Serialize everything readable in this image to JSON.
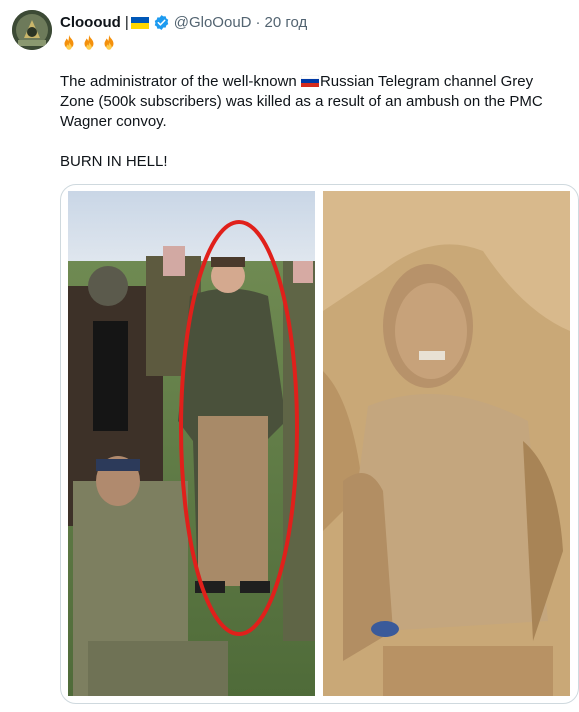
{
  "author": {
    "name": "Cloooud",
    "separator": "|",
    "flag_icon": "ukraine-flag-icon",
    "verified_icon": "verified-badge-icon",
    "handle": "@GloOouD",
    "dot": "·",
    "time": "20 год",
    "accent_color": "#1d9bf0"
  },
  "tweet": {
    "emoji_icons": [
      "fire-icon",
      "fire-icon",
      "fire-icon"
    ],
    "paragraph1_before": "The administrator of the well-known ",
    "paragraph1_flag": "russia-flag-icon",
    "paragraph1_after": "Russian Telegram channel Grey Zone (500k subscribers) was killed as a result of an ambush on the PMC Wagner convoy.",
    "paragraph2": "BURN IN HELL!"
  },
  "media": {
    "left_photo": "group-photo-with-highlighted-person",
    "highlight_color": "#e0201b",
    "right_photo": "body-photo"
  }
}
